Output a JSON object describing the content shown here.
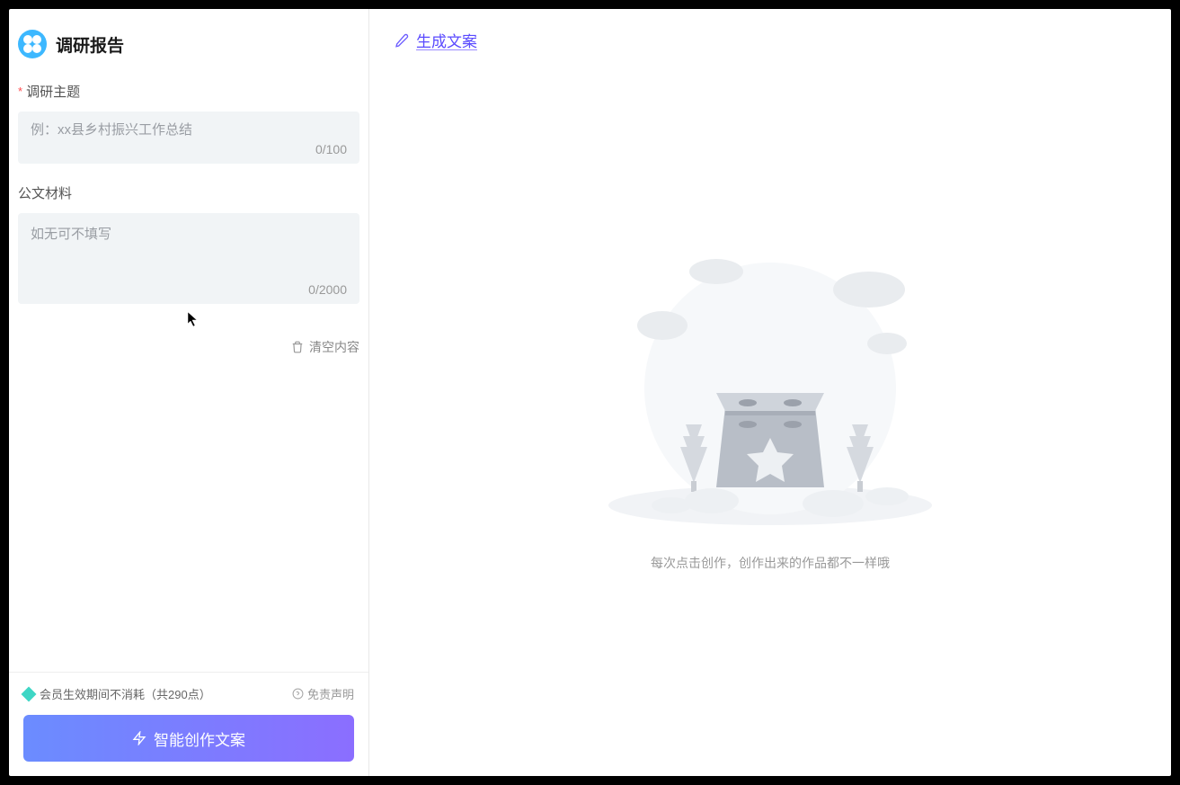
{
  "app": {
    "title": "调研报告"
  },
  "form": {
    "topic": {
      "label": "调研主题",
      "required": true,
      "placeholder": "例：xx县乡村振兴工作总结",
      "value": "",
      "counter": "0/100"
    },
    "material": {
      "label": "公文材料",
      "placeholder": "如无可不填写",
      "value": "",
      "counter": "0/2000"
    },
    "clear_label": "清空内容"
  },
  "footer": {
    "points_info": "会员生效期间不消耗（共290点）",
    "disclaimer": "免责声明",
    "create_button": "智能创作文案"
  },
  "main": {
    "header_title": "生成文案",
    "empty_text": "每次点击创作，创作出来的作品都不一样哦"
  }
}
